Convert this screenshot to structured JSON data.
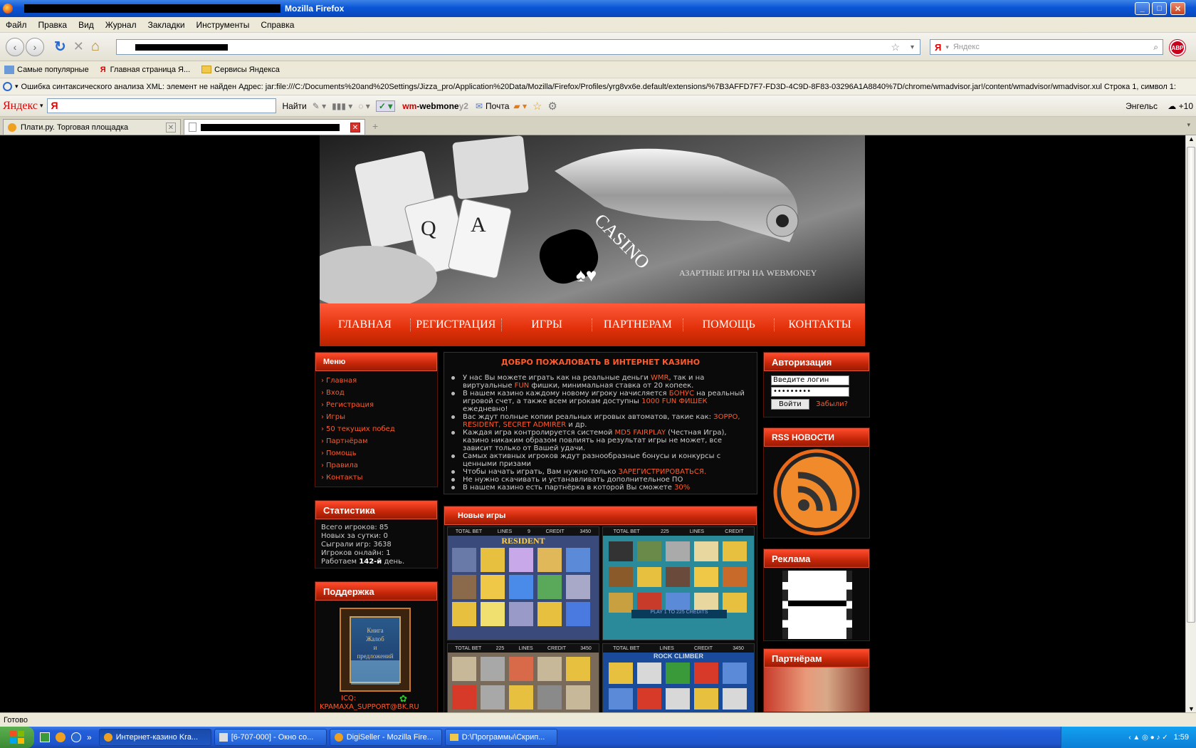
{
  "window": {
    "title": "Mozilla Firefox",
    "minimize": "_",
    "maximize": "□",
    "close": "✕"
  },
  "menubar": [
    "Файл",
    "Правка",
    "Вид",
    "Журнал",
    "Закладки",
    "Инструменты",
    "Справка"
  ],
  "nav": {
    "back": "‹",
    "forward": "›",
    "reload": "↻",
    "stop": "✕",
    "home": "⌂",
    "search_placeholder": "Яндекс"
  },
  "bookmarks": [
    "Самые популярные",
    "Главная страница Я...",
    "Сервисы Яндекса"
  ],
  "error_bar": "Ошибка синтаксического анализа XML: элемент не найден Адрес: jar:file:///C:/Documents%20and%20Settings/Jizza_pro/Application%20Data/Mozilla/Firefox/Profiles/yrg8vx6e.default/extensions/%7B3AFFD7F7-FD3D-4C9D-8F83-03296A1A8840%7D/chrome/wmadvisor.jar!/content/wmadvisor/wmadvisor.xul Строка 1, символ 1:",
  "yandex_bar": {
    "logo": "Яндекс",
    "find": "Найти",
    "webmoney": "wm-webmoney",
    "webmoney_suffix": "2",
    "mail": "Почта",
    "city": "Энгельс",
    "weather": "+10"
  },
  "tabs": [
    {
      "label": "Плати.ру. Торговая площадка"
    },
    {
      "label": ""
    }
  ],
  "site": {
    "banner_casino": "CASINO",
    "banner_slogan": "АЗАРТНЫЕ ИГРЫ НА WEBMONEY",
    "nav": [
      "ГЛАВНАЯ",
      "РЕГИСТРАЦИЯ",
      "ИГРЫ",
      "ПАРТНЕРАМ",
      "ПОМОЩЬ",
      "КОНТАКТЫ"
    ],
    "menu": {
      "title": "Меню",
      "items": [
        "Главная",
        "Вход",
        "Регистрация",
        "Игры",
        "50 текущих побед",
        "Партнёрам",
        "Помощь",
        "Правила",
        "Контакты"
      ]
    },
    "stats": {
      "title": "Статистика",
      "lines": [
        "Всего игроков: 85",
        "Новых за сутки: 0",
        "Сыграли игр: 3638",
        "Игроков онлайн: 1"
      ],
      "days_prefix": "Работаем ",
      "days_value": "142-й",
      "days_suffix": " день."
    },
    "support": {
      "title": "Поддержка",
      "book_line1": "Книга",
      "book_line2": "Жалоб",
      "book_line3": "и",
      "book_line4": "предложений",
      "icq": "ICQ:",
      "email": "KPAMAXA_SUPPORT@BK.RU"
    },
    "welcome": {
      "title": "ДОБРО ПОЖАЛОВАТЬ В ИНТЕРНЕТ КАЗИНО",
      "p1a": "У нас Вы можете играть как на реальные деньги ",
      "p1b": "WMR",
      "p1c": ", так и на виртуальные ",
      "p1d": "FUN",
      "p1e": " фишки, минимальная ставка от 20 копеек.",
      "p2a": "В нашем казино каждому новому игроку начисляется ",
      "p2b": "БОНУС",
      "p2c": " на реальный игровой счет, а также всем игрокам доступны ",
      "p2d": "1000 FUN ФИШЕК",
      "p2e": " ежедневно!",
      "p3a": "Вас ждут полные копии реальных игровых автоматов, такие как: ",
      "p3b": "ЗОРРО, RESIDENT, SECRET ADMIRER",
      "p3c": " и др.",
      "p4a": "Каждая игра контролируется системой ",
      "p4b": "MD5 FAIRPLAY",
      "p4c": " (Честная Игра), казино никаким образом повлиять на результат игры не может, все зависит только от Вашей удачи.",
      "p5": "Самых активных игроков ждут разнообразные бонусы и конкурсы с ценными призами",
      "p6a": "Чтобы начать играть, Вам нужно только ",
      "p6b": "ЗАРЕГИСТРИРОВАТЬСЯ.",
      "p7": "Не нужно скачивать и устанавливать дополнительное ПО",
      "p8a": "В нашем казино есть партнёрка в которой Вы сможете ",
      "p8b": "30%"
    },
    "new_games": {
      "title": "Новые игры",
      "slot1_name": "RESIDENT",
      "slot3_name": "ROCK CLIMBER",
      "total_bet": "TOTAL BET",
      "lines": "LINES",
      "credit": "CREDIT",
      "credit_value": "3450",
      "bet_value": "225",
      "lines_value": "9",
      "play_text": "PLAY 1 TO 225 CREDITS"
    },
    "auth": {
      "title": "Авторизация",
      "login_value": "Введите логин",
      "password_value": "•••••••••",
      "login_button": "Войти",
      "forgot": "Забыли?"
    },
    "rss": {
      "title": "RSS НОВОСТИ"
    },
    "ads": {
      "title": "Реклама"
    },
    "partners": {
      "title": "Партнёрам"
    }
  },
  "status": "Готово",
  "taskbar": {
    "items": [
      "Интернет-казино Kra...",
      "[6-707-000] - Окно со...",
      "DigiSeller - Mozilla Fire...",
      "D:\\Программы\\Скрип..."
    ],
    "time": "1:59"
  },
  "colors": {
    "accent_red": "#e0300a",
    "link_orange": "#ff5a2c",
    "xp_blue": "#245edb"
  }
}
